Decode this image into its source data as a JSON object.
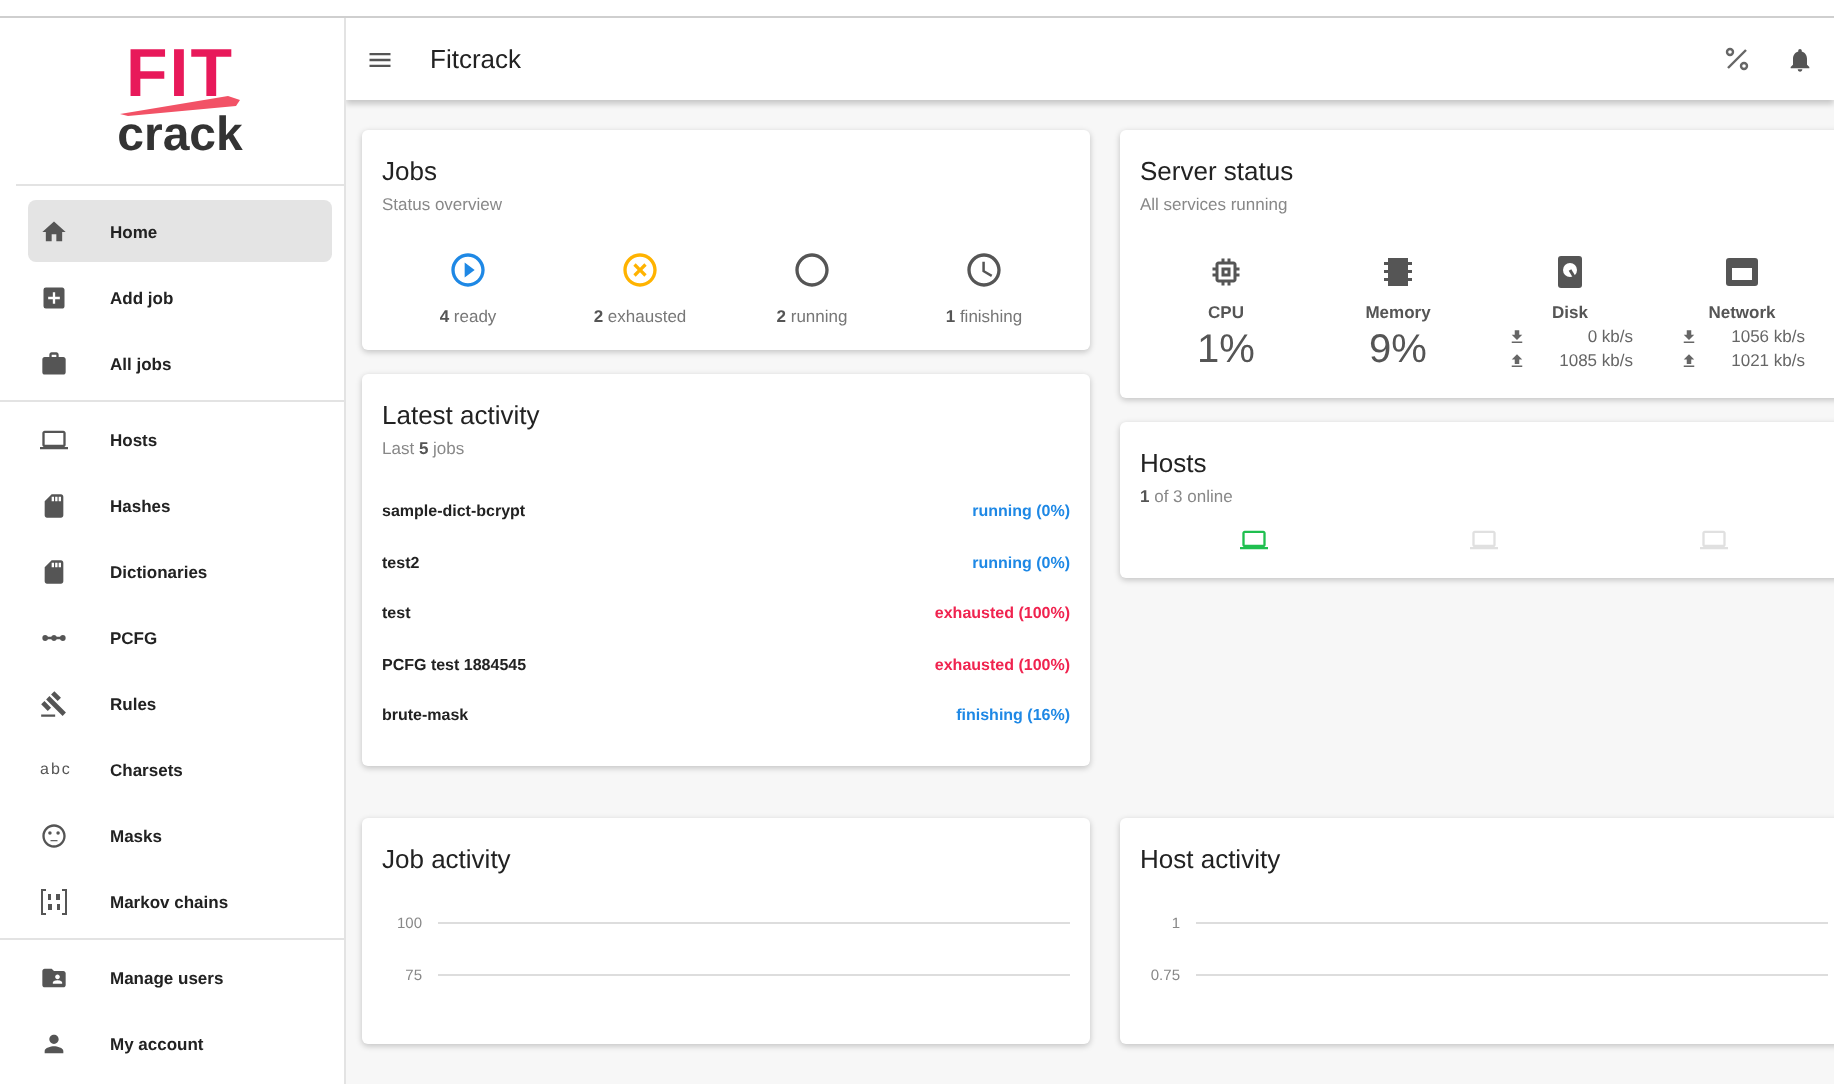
{
  "app_bar": {
    "title": "Fitcrack"
  },
  "logo": {
    "top": "FIT",
    "bottom": "crack"
  },
  "sidebar": {
    "groups": [
      [
        {
          "label": "Home",
          "selected": true
        },
        {
          "label": "Add job",
          "selected": false
        },
        {
          "label": "All jobs",
          "selected": false
        }
      ],
      [
        {
          "label": "Hosts",
          "selected": false
        },
        {
          "label": "Hashes",
          "selected": false
        },
        {
          "label": "Dictionaries",
          "selected": false
        },
        {
          "label": "PCFG",
          "selected": false
        },
        {
          "label": "Rules",
          "selected": false
        },
        {
          "label": "Charsets",
          "icon_text": "abc",
          "selected": false
        },
        {
          "label": "Masks",
          "selected": false
        },
        {
          "label": "Markov chains",
          "selected": false
        }
      ],
      [
        {
          "label": "Manage users",
          "selected": false
        },
        {
          "label": "My account",
          "selected": false
        }
      ]
    ]
  },
  "jobs": {
    "title": "Jobs",
    "subtitle": "Status overview",
    "states": [
      {
        "kind": "ready",
        "text": "**4** ready"
      },
      {
        "kind": "exhausted",
        "text": "**2** exhausted"
      },
      {
        "kind": "running",
        "text": "**2** running"
      },
      {
        "kind": "finishing",
        "text": "**1** finishing"
      }
    ]
  },
  "latest_activity": {
    "title": "Latest activity",
    "subtitle": "Last **5** jobs",
    "rows": [
      {
        "name": "sample-dict-bcrypt",
        "status": "running (0%)",
        "kind": "running"
      },
      {
        "name": "test2",
        "status": "running (0%)",
        "kind": "running"
      },
      {
        "name": "test",
        "status": "exhausted (100%)",
        "kind": "exhausted"
      },
      {
        "name": "PCFG test 1884545",
        "status": "exhausted (100%)",
        "kind": "exhausted"
      },
      {
        "name": "brute-mask",
        "status": "finishing (16%)",
        "kind": "finishing"
      }
    ]
  },
  "server_status": {
    "title": "Server status",
    "subtitle": "All services running",
    "metrics": [
      {
        "kind": "cpu",
        "label": "CPU",
        "value": "1%"
      },
      {
        "kind": "memory",
        "label": "Memory",
        "value": "9%"
      },
      {
        "kind": "disk",
        "label": "Disk",
        "download": "0 kb/s",
        "upload": "1085 kb/s"
      },
      {
        "kind": "network",
        "label": "Network",
        "download": "1056 kb/s",
        "upload": "1021 kb/s"
      }
    ]
  },
  "hosts": {
    "title": "Hosts",
    "subtitle": "**1** of 3 online",
    "items": [
      {
        "online": true
      },
      {
        "online": false
      },
      {
        "online": false
      }
    ]
  },
  "job_activity": {
    "title": "Job activity",
    "gridline_labels": [
      "100",
      "75"
    ]
  },
  "host_activity": {
    "title": "Host activity",
    "gridline_labels": [
      "1",
      "0.75"
    ]
  }
}
